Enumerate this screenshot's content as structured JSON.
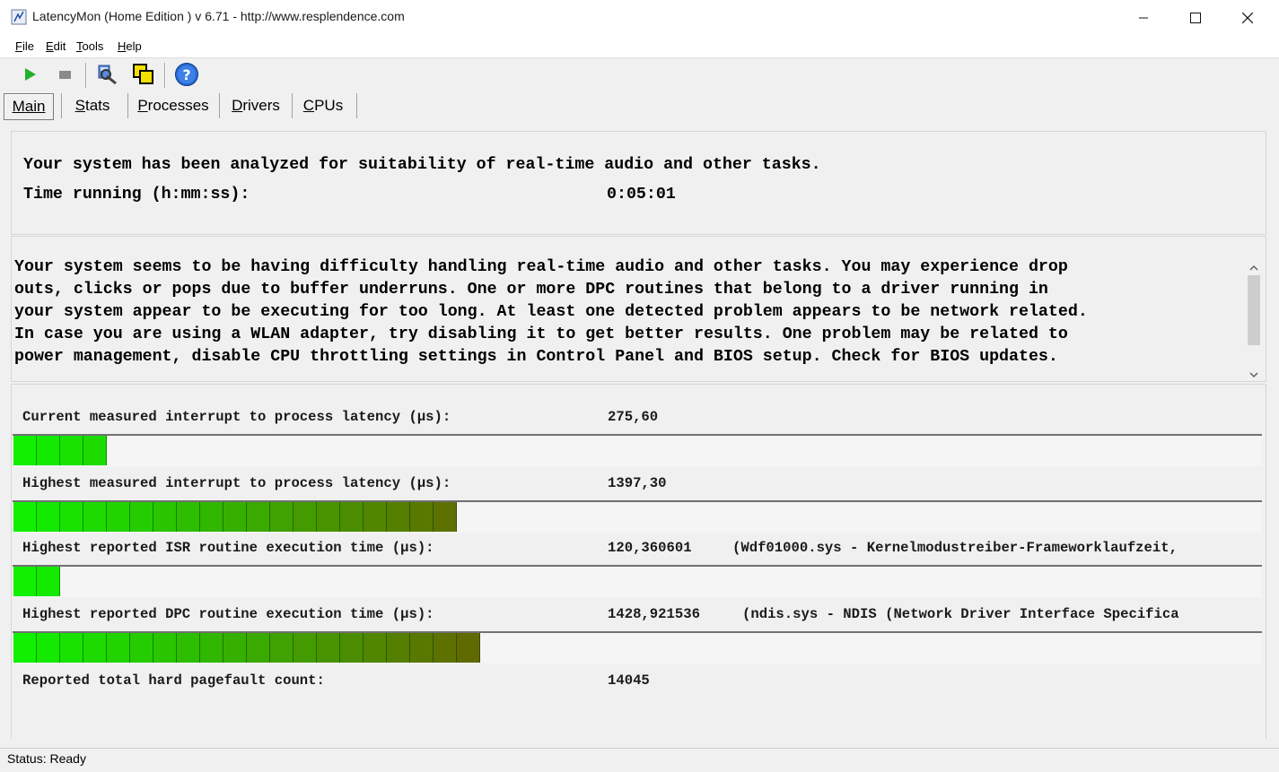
{
  "window": {
    "title": "LatencyMon  (Home Edition )  v 6.71 - http://www.resplendence.com",
    "minimize_icon": "minimize-icon",
    "maximize_icon": "maximize-icon",
    "close_icon": "close-icon"
  },
  "menu": [
    {
      "accel": "F",
      "rest": "ile"
    },
    {
      "accel": "E",
      "rest": "dit"
    },
    {
      "accel": "T",
      "rest": "ools"
    },
    {
      "accel": "H",
      "rest": "elp"
    }
  ],
  "toolbar": {
    "icons": [
      "play-icon",
      "stop-icon",
      "driver-inspect-icon",
      "windows-icon",
      "help-icon"
    ]
  },
  "tabs": [
    {
      "accel": "M",
      "rest": "ain",
      "active": true
    },
    {
      "accel": "S",
      "rest": "tats",
      "active": false
    },
    {
      "accel": "P",
      "rest": "rocesses",
      "active": false
    },
    {
      "accel": "D",
      "rest": "rivers",
      "active": false
    },
    {
      "accel": "C",
      "rest": "PUs",
      "active": false
    }
  ],
  "summary": {
    "line1": "Your system has been analyzed for suitability of real-time audio and other tasks.",
    "time_label": "Time running (h:mm:ss):",
    "time_value": "0:05:01"
  },
  "message": "Your system seems to be having difficulty handling real-time audio and other tasks. You may experience drop\nouts, clicks or pops due to buffer underruns. One or more DPC routines that belong to a driver running in\nyour system appear to be executing for too long. At least one detected problem appears to be network related.\nIn case you are using a WLAN adapter, try disabling it to get better results. One problem may be related to\npower management, disable CPU throttling settings in Control Panel and BIOS setup. Check for BIOS updates.",
  "metrics": [
    {
      "label": "Current measured interrupt to process latency (µs):",
      "value": "275,60",
      "detail": "",
      "level": 0.074
    },
    {
      "label": "Highest measured interrupt to process latency (µs):",
      "value": "1397,30",
      "detail": "",
      "level": 0.356
    },
    {
      "label": "Highest reported ISR routine execution time (µs):",
      "value": "120,360601",
      "detail": "(Wdf01000.sys - Kernelmodustreiber-Frameworklaufzeit,",
      "level": 0.038
    },
    {
      "label": "Highest reported DPC routine execution time (µs):",
      "value": "1428,921536",
      "detail": "(ndis.sys - NDIS (Network Driver Interface Specifica",
      "level": 0.373
    }
  ],
  "pagefault": {
    "label": "Reported total hard pagefault count:",
    "value": "14045"
  },
  "status": "Status: Ready",
  "colors": {
    "bar_start": "#10f000",
    "bar_end": "#6a5a00"
  }
}
